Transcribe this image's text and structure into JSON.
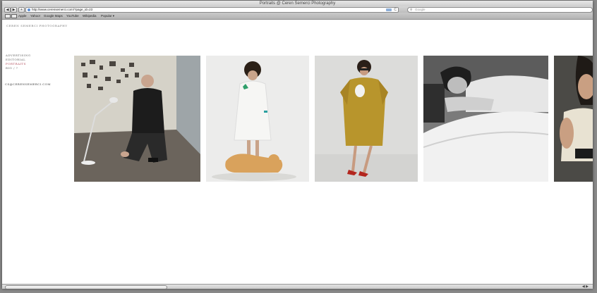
{
  "window": {
    "title": "Portraits @ Ceren Semerci Photography"
  },
  "toolbar": {
    "back_glyph": "◀",
    "forward_glyph": "▶",
    "add_glyph": "+",
    "url": "http://www.cerensemerci.com/?page_id=23",
    "reload_glyph": "C",
    "search_glyph": "⚲",
    "search_placeholder": "Google"
  },
  "bookmarks": {
    "items": [
      "Apple",
      "Yahoo!",
      "Google Maps",
      "YouTube",
      "Wikipedia",
      "Popular ▾"
    ]
  },
  "site": {
    "title": "Ceren Semerci Photography",
    "nav": [
      "Advertising",
      "Editorial",
      "Portraits",
      "Bio / ?"
    ],
    "active_nav_index": 2,
    "contact": "CS@CERENSEMERCI.COM"
  },
  "statusbar": {
    "arrows": "◀ ▶"
  },
  "colors": {
    "active_nav": "#b04a5a",
    "link_accent": "#5b8fd6"
  },
  "icons": {
    "back": "back-arrow-icon",
    "forward": "forward-arrow-icon",
    "add": "add-bookmark-icon",
    "reload": "reload-icon",
    "search": "magnifier-icon",
    "reading_list": "book-icon",
    "bookmarks_grid": "grid-icon"
  }
}
